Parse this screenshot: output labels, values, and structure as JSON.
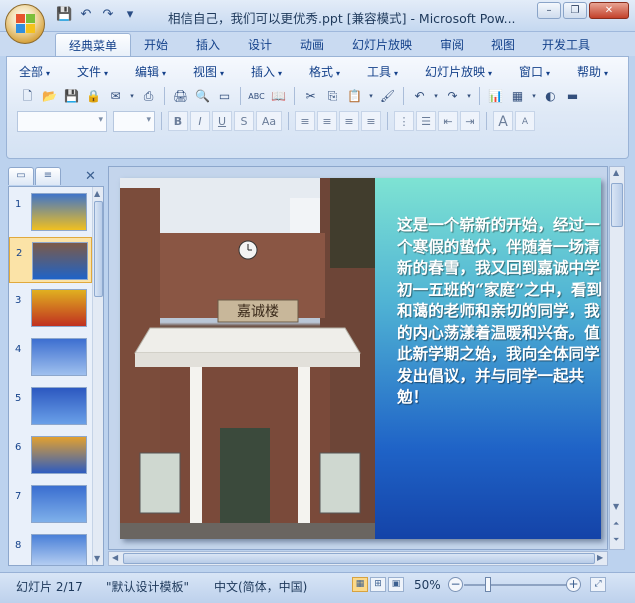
{
  "window": {
    "title": "相信自己，我们可以更优秀.ppt [兼容模式] - Microsoft Pow...",
    "controls": {
      "minimize": "–",
      "restore": "❐",
      "close": "✕"
    }
  },
  "ribbon_tabs": [
    "经典菜单",
    "开始",
    "插入",
    "设计",
    "动画",
    "幻灯片放映",
    "审阅",
    "视图",
    "开发工具"
  ],
  "menus": [
    "全部",
    "文件",
    "编辑",
    "视图",
    "插入",
    "格式",
    "工具",
    "幻灯片放映",
    "窗口",
    "帮助"
  ],
  "toolbar_glyphs": {
    "new": "🗋",
    "open": "📂",
    "save": "💾",
    "perm": "🔒",
    "print": "🖨",
    "preview": "🔍",
    "spell": "ABC",
    "cut": "✂",
    "copy": "⎘",
    "paste": "📋",
    "brush": "🖌",
    "undo": "↶",
    "redo": "↷",
    "chart": "📊",
    "table": "▦",
    "help": "?"
  },
  "format_glyphs": {
    "bold": "B",
    "italic": "I",
    "underline": "U",
    "strike": "S",
    "case": "Aa",
    "align_l": "≡",
    "align_c": "≡",
    "align_r": "≡",
    "justify": "≡",
    "grow": "A",
    "shrink": "A"
  },
  "thumbnails": [
    {
      "num": "1",
      "top": "#3f74c9",
      "bottom": "#f0c020"
    },
    {
      "num": "2",
      "top": "#7c5a48",
      "bottom": "#1f63c7"
    },
    {
      "num": "3",
      "top": "#e0b020",
      "bottom": "#c03020"
    },
    {
      "num": "4",
      "top": "#3d6fd0",
      "bottom": "#9fc0ee"
    },
    {
      "num": "5",
      "top": "#2c58c0",
      "bottom": "#6aa0e8"
    },
    {
      "num": "6",
      "top": "#e2a030",
      "bottom": "#2e5cc0"
    },
    {
      "num": "7",
      "top": "#3a6ed0",
      "bottom": "#7fb0ea"
    },
    {
      "num": "8",
      "top": "#4a80d8",
      "bottom": "#c8dcf6"
    }
  ],
  "slide": {
    "sign_text": "嘉诚楼",
    "body": "这是一个崭新的开始，经过一个寒假的蛰伏，伴随着一场清新的春雪，我又回到嘉诚中学初一五班的“家庭”之中，看到和蔼的老师和亲切的同学，我的内心荡漾着温暖和兴奋。值此新学期之始，我向全体同学发出倡议，并与同学一起共勉！"
  },
  "status": {
    "slide_info": "幻灯片 2/17",
    "template": "\"默认设计模板\"",
    "language": "中文(简体，中国)",
    "zoom": "50%",
    "zoom_level": 0.5
  }
}
